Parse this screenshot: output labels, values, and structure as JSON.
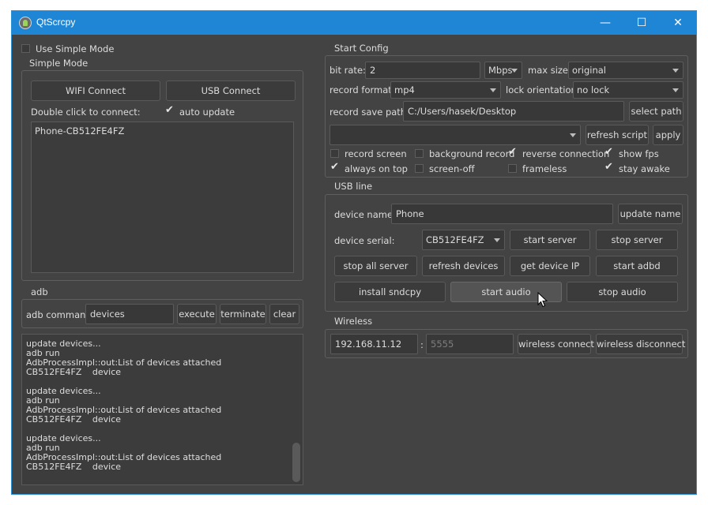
{
  "window": {
    "title": "QtScrcpy",
    "minimize": "—",
    "maximize": "☐",
    "close": "✕"
  },
  "left": {
    "use_simple_mode": {
      "label": "Use Simple Mode",
      "checked": false
    },
    "simple_mode": {
      "title": "Simple Mode",
      "wifi_connect": "WIFI Connect",
      "usb_connect": "USB Connect",
      "double_click_label": "Double click to connect:",
      "auto_update": {
        "label": "auto update",
        "checked": true
      },
      "devices": [
        "Phone-CB512FE4FZ"
      ]
    },
    "adb": {
      "title": "adb",
      "command_label": "adb command:",
      "command_value": "devices",
      "execute": "execute",
      "terminate": "terminate",
      "clear": "clear",
      "log": [
        "update devices...",
        "adb run",
        "AdbProcessImpl::out:List of devices attached",
        "CB512FE4FZ\tdevice",
        "",
        "update devices...",
        "adb run",
        "AdbProcessImpl::out:List of devices attached",
        "CB512FE4FZ\tdevice",
        "",
        "update devices...",
        "adb run",
        "AdbProcessImpl::out:List of devices attached",
        "CB512FE4FZ\tdevice"
      ]
    }
  },
  "start_config": {
    "title": "Start Config",
    "bit_rate_label": "bit rate:",
    "bit_rate_value": "2",
    "bit_rate_unit": "Mbps",
    "max_size_label": "max size:",
    "max_size_value": "original",
    "record_format_label": "record format:",
    "record_format_value": "mp4",
    "lock_orientation_label": "lock orientation:",
    "lock_orientation_value": "no lock",
    "record_save_path_label": "record save path:",
    "record_save_path_value": "C:/Users/hasek/Desktop",
    "select_path": "select path",
    "script_value": "",
    "refresh_script": "refresh script",
    "apply": "apply",
    "checks": {
      "record_screen": {
        "label": "record screen",
        "checked": false
      },
      "background_record": {
        "label": "background record",
        "checked": false
      },
      "reverse_connection": {
        "label": "reverse connection",
        "checked": true
      },
      "show_fps": {
        "label": "show fps",
        "checked": true
      },
      "always_on_top": {
        "label": "always on top",
        "checked": true
      },
      "screen_off": {
        "label": "screen-off",
        "checked": false
      },
      "frameless": {
        "label": "frameless",
        "checked": false
      },
      "stay_awake": {
        "label": "stay awake",
        "checked": true
      }
    }
  },
  "usb_line": {
    "title": "USB line",
    "device_name_label": "device name:",
    "device_name_value": "Phone",
    "update_name": "update name",
    "device_serial_label": "device serial:",
    "device_serial_value": "CB512FE4FZ",
    "start_server": "start server",
    "stop_server": "stop server",
    "stop_all_server": "stop all server",
    "refresh_devices": "refresh devices",
    "get_device_ip": "get device IP",
    "start_adbd": "start adbd",
    "install_sndcpy": "install sndcpy",
    "start_audio": "start audio",
    "stop_audio": "stop audio"
  },
  "wireless": {
    "title": "Wireless",
    "ip_value": "192.168.11.12",
    "separator": ":",
    "port_placeholder": "5555",
    "wireless_connect": "wireless connect",
    "wireless_disconnect": "wireless disconnect"
  }
}
